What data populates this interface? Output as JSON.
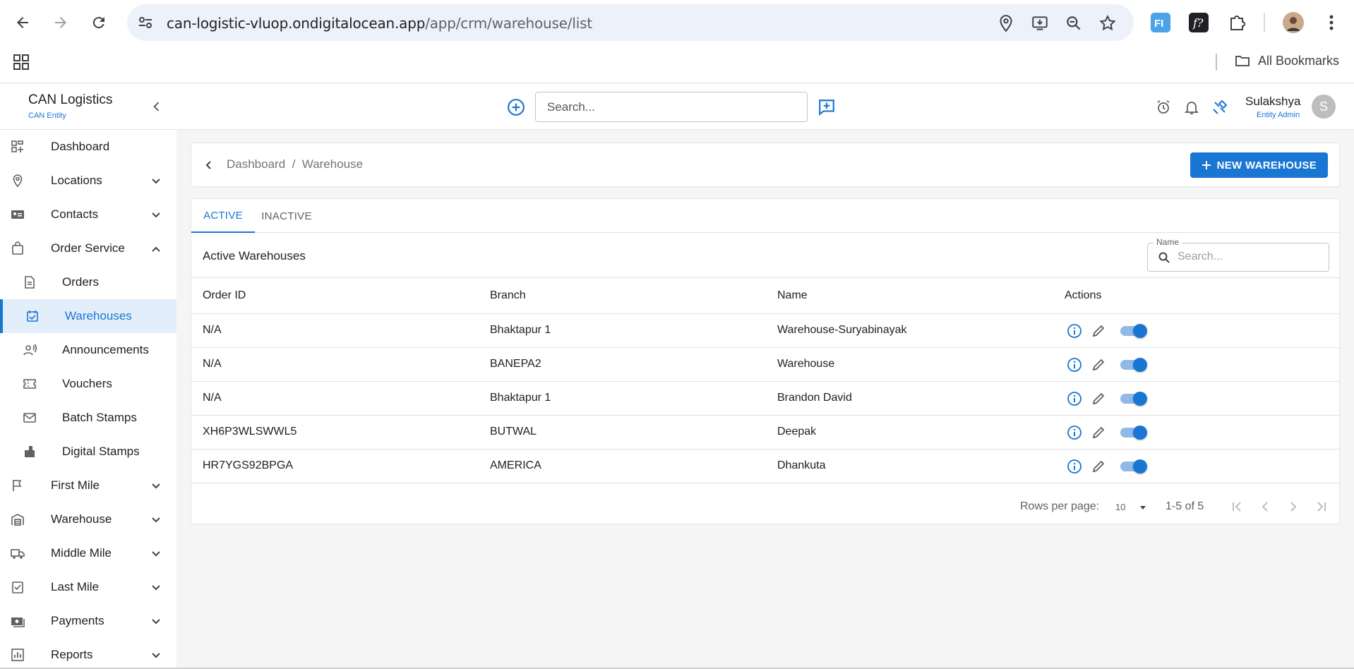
{
  "browser": {
    "url_host": "can-logistic-vluop.ondigitalocean.app",
    "url_path": "/app/crm/warehouse/list",
    "all_bookmarks": "All Bookmarks"
  },
  "header": {
    "brand": "CAN Logistics",
    "brand_sub": "CAN Entity",
    "search_placeholder": "Search...",
    "user_name": "Sulakshya",
    "user_role": "Entity Admin",
    "avatar_letter": "S"
  },
  "sidebar": {
    "items": [
      {
        "label": "Dashboard",
        "icon": "dashboard-icon",
        "expandable": false
      },
      {
        "label": "Locations",
        "icon": "location-pin-icon",
        "expandable": true
      },
      {
        "label": "Contacts",
        "icon": "contact-card-icon",
        "expandable": true
      },
      {
        "label": "Order Service",
        "icon": "shopping-bag-icon",
        "expandable": true,
        "expanded": true
      },
      {
        "label": "Orders",
        "icon": "document-icon",
        "sub": true
      },
      {
        "label": "Warehouses",
        "icon": "warehouse-check-icon",
        "sub": true,
        "active": true
      },
      {
        "label": "Announcements",
        "icon": "announcement-icon",
        "sub": true
      },
      {
        "label": "Vouchers",
        "icon": "voucher-icon",
        "sub": true
      },
      {
        "label": "Batch Stamps",
        "icon": "mail-icon",
        "sub": true
      },
      {
        "label": "Digital Stamps",
        "icon": "stamp-icon",
        "sub": true
      },
      {
        "label": "First Mile",
        "icon": "flag-icon",
        "expandable": true
      },
      {
        "label": "Warehouse",
        "icon": "warehouse-icon",
        "expandable": true
      },
      {
        "label": "Middle Mile",
        "icon": "truck-icon",
        "expandable": true
      },
      {
        "label": "Last Mile",
        "icon": "checklist-icon",
        "expandable": true
      },
      {
        "label": "Payments",
        "icon": "payments-icon",
        "expandable": true
      },
      {
        "label": "Reports",
        "icon": "reports-icon",
        "expandable": true
      }
    ]
  },
  "breadcrumb": {
    "text": "Dashboard  /  Warehouse",
    "new_button": "NEW WAREHOUSE"
  },
  "tabs": [
    {
      "label": "ACTIVE",
      "active": true
    },
    {
      "label": "INACTIVE",
      "active": false
    }
  ],
  "table": {
    "title": "Active Warehouses",
    "filter_label": "Name",
    "filter_placeholder": "Search...",
    "columns": [
      "Order ID",
      "Branch",
      "Name",
      "Actions"
    ],
    "rows": [
      {
        "order_id": "N/A",
        "branch": "Bhaktapur 1",
        "name": "Warehouse-Suryabinayak",
        "enabled": true
      },
      {
        "order_id": "N/A",
        "branch": "BANEPA2",
        "name": "Warehouse",
        "enabled": true
      },
      {
        "order_id": "N/A",
        "branch": "Bhaktapur 1",
        "name": "Brandon David",
        "enabled": true
      },
      {
        "order_id": "XH6P3WLSWWL5",
        "branch": "BUTWAL",
        "name": "Deepak",
        "enabled": true
      },
      {
        "order_id": "HR7YGS92BPGA",
        "branch": "AMERICA",
        "name": "Dhankuta",
        "enabled": true
      }
    ]
  },
  "pagination": {
    "rows_per_page_label": "Rows per page:",
    "rows_per_page": "10",
    "range": "1-5 of 5"
  },
  "colors": {
    "primary": "#1976d2",
    "sidebar_active_bg": "#e3eefb",
    "content_bg": "#f5f5f5"
  }
}
